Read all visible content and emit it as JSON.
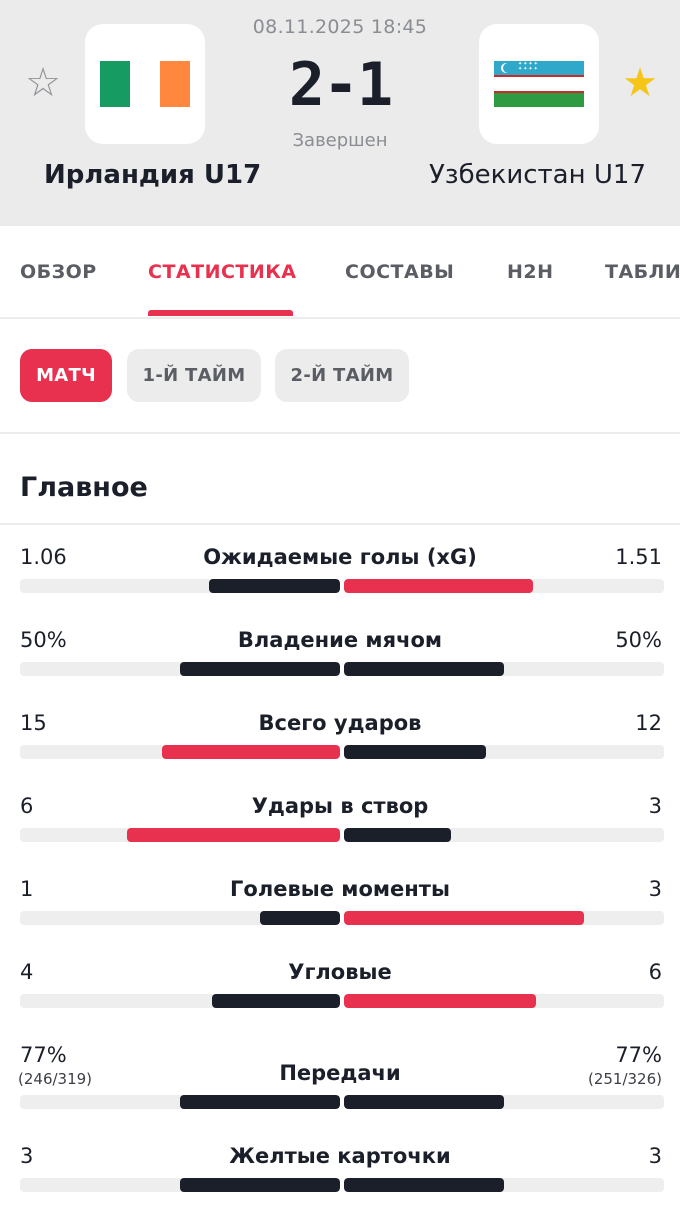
{
  "match": {
    "datetime": "08.11.2025 18:45",
    "score": "2-1",
    "status": "Завершен",
    "home": {
      "name": "Ирландия U17",
      "favorite": false
    },
    "away": {
      "name": "Узбекистан U17",
      "favorite": true
    }
  },
  "icons": {
    "fav_home": "star-outline-icon",
    "fav_away": "star-filled-icon",
    "flag_home": "ireland-flag",
    "flag_away": "uzbekistan-flag"
  },
  "tabs": [
    {
      "label": "ОБЗОР",
      "active": false
    },
    {
      "label": "СТАТИСТИКА",
      "active": true
    },
    {
      "label": "СОСТАВЫ",
      "active": false
    },
    {
      "label": "H2H",
      "active": false
    },
    {
      "label": "ТАБЛИ",
      "active": false
    }
  ],
  "periods": [
    {
      "label": "МАТЧ",
      "active": true
    },
    {
      "label": "1-Й ТАЙМ",
      "active": false
    },
    {
      "label": "2-Й ТАЙМ",
      "active": false
    }
  ],
  "section": {
    "title": "Главное"
  },
  "colors": {
    "accent": "#e8304f",
    "dark": "#1b1f2a",
    "track": "#eeeeee"
  },
  "stats": [
    {
      "label": "Ожидаемые голы (xG)",
      "home": "1.06",
      "away": "1.51",
      "home_fraction": 0.41,
      "away_fraction": 0.59,
      "home_color": "dark",
      "away_color": "accent"
    },
    {
      "label": "Владение мячом",
      "home": "50%",
      "away": "50%",
      "home_fraction": 0.5,
      "away_fraction": 0.5,
      "home_color": "dark",
      "away_color": "dark"
    },
    {
      "label": "Всего ударов",
      "home": "15",
      "away": "12",
      "home_fraction": 0.556,
      "away_fraction": 0.444,
      "home_color": "accent",
      "away_color": "dark"
    },
    {
      "label": "Удары в створ",
      "home": "6",
      "away": "3",
      "home_fraction": 0.667,
      "away_fraction": 0.333,
      "home_color": "accent",
      "away_color": "dark"
    },
    {
      "label": "Голевые моменты",
      "home": "1",
      "away": "3",
      "home_fraction": 0.25,
      "away_fraction": 0.75,
      "home_color": "dark",
      "away_color": "accent"
    },
    {
      "label": "Угловые",
      "home": "4",
      "away": "6",
      "home_fraction": 0.4,
      "away_fraction": 0.6,
      "home_color": "dark",
      "away_color": "accent"
    },
    {
      "label": "Передачи",
      "home": "77%",
      "away": "77%",
      "home_sub": "(246/319)",
      "away_sub": "(251/326)",
      "home_fraction": 0.5,
      "away_fraction": 0.5,
      "home_color": "dark",
      "away_color": "dark"
    },
    {
      "label": "Желтые карточки",
      "home": "3",
      "away": "3",
      "home_fraction": 0.5,
      "away_fraction": 0.5,
      "home_color": "dark",
      "away_color": "dark"
    }
  ]
}
